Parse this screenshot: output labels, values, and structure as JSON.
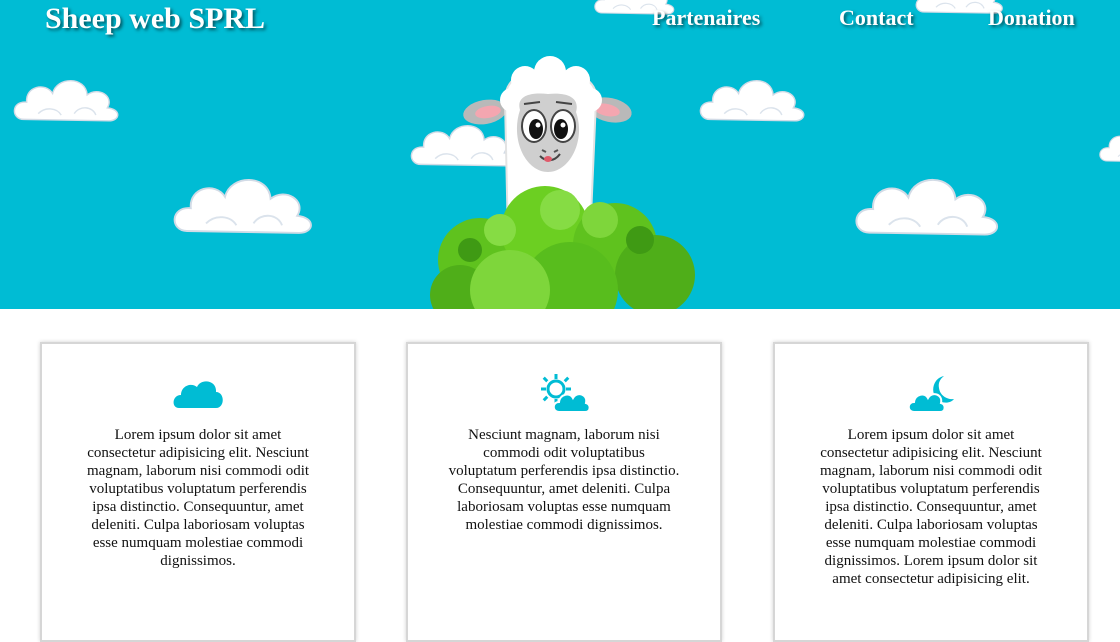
{
  "header": {
    "brand": "Sheep web SPRL",
    "nav": [
      "Partenaires",
      "Contact",
      "Donation"
    ]
  },
  "hero": {
    "sky_color": "#00bcd4",
    "illustration": "sheep-behind-bush"
  },
  "cards": [
    {
      "icon": "cloud-icon",
      "text": "Lorem ipsum dolor sit amet consectetur adipisicing elit. Nesciunt magnam, laborum nisi commodi odit voluptatibus voluptatum perferendis ipsa distinctio. Consequuntur, amet deleniti. Culpa laboriosam voluptas esse numquam molestiae commodi dignissimos."
    },
    {
      "icon": "sun-cloud-icon",
      "text": "Nesciunt magnam, laborum nisi commodi odit voluptatibus voluptatum perferendis ipsa distinctio. Consequuntur, amet deleniti. Culpa laboriosam voluptas esse numquam molestiae commodi dignissimos."
    },
    {
      "icon": "moon-cloud-icon",
      "text": "Lorem ipsum dolor sit amet consectetur adipisicing elit. Nesciunt magnam, laborum nisi commodi odit voluptatibus voluptatum perferendis ipsa distinctio. Consequuntur, amet deleniti. Culpa laboriosam voluptas esse numquam molestiae commodi dignissimos. Lorem ipsum dolor sit amet consectetur adipisicing elit."
    }
  ],
  "colors": {
    "accent": "#00bcd4",
    "card_border": "#d6d6d6"
  }
}
